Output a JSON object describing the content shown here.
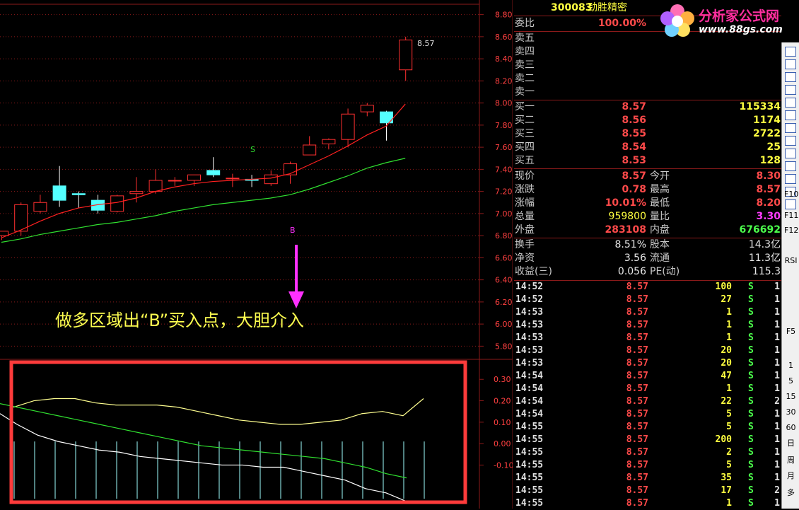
{
  "stock": {
    "code": "300083",
    "name": "劲胜精密"
  },
  "annotation": {
    "text": "做多区域出“B”买入点，大胆介入",
    "buy_marker": "B",
    "sell_marker": "S",
    "last_label": "8.57"
  },
  "price_axis": [
    "8.80",
    "8.60",
    "8.40",
    "8.20",
    "8.00",
    "7.80",
    "7.60",
    "7.40",
    "7.20",
    "7.00",
    "6.80",
    "6.60",
    "6.40",
    "6.20",
    "6.00",
    "5.80"
  ],
  "indicator_axis": [
    "0.30",
    "0.20",
    "0.10",
    "0.00",
    "-0.10"
  ],
  "colors": {
    "up": "#ff3030",
    "down": "#54ffff",
    "ma_short": "#ff2020",
    "ma_long": "#30e030",
    "highlight_box": "#ff3b3b",
    "grid": "#8b1a1a",
    "arrow": "#ff30ff"
  },
  "chart_data": [
    {
      "type": "candlestick",
      "ylim": [
        5.7,
        8.9
      ],
      "candles": [
        {
          "o": 6.8,
          "h": 6.84,
          "l": 6.76,
          "c": 6.84
        },
        {
          "o": 6.84,
          "h": 7.1,
          "l": 6.8,
          "c": 7.08
        },
        {
          "o": 7.02,
          "h": 7.17,
          "l": 7.0,
          "c": 7.1
        },
        {
          "o": 7.25,
          "h": 7.43,
          "l": 7.06,
          "c": 7.12
        },
        {
          "o": 7.18,
          "h": 7.2,
          "l": 7.05,
          "c": 7.17
        },
        {
          "o": 7.12,
          "h": 7.17,
          "l": 7.0,
          "c": 7.03
        },
        {
          "o": 7.02,
          "h": 7.17,
          "l": 7.01,
          "c": 7.16
        },
        {
          "o": 7.18,
          "h": 7.33,
          "l": 7.1,
          "c": 7.2
        },
        {
          "o": 7.2,
          "h": 7.4,
          "l": 7.18,
          "c": 7.3
        },
        {
          "o": 7.3,
          "h": 7.33,
          "l": 7.25,
          "c": 7.3
        },
        {
          "o": 7.3,
          "h": 7.35,
          "l": 7.25,
          "c": 7.35
        },
        {
          "o": 7.39,
          "h": 7.51,
          "l": 7.33,
          "c": 7.35
        },
        {
          "o": 7.32,
          "h": 7.36,
          "l": 7.24,
          "c": 7.32
        },
        {
          "o": 7.31,
          "h": 7.35,
          "l": 7.24,
          "c": 7.3
        },
        {
          "o": 7.27,
          "h": 7.39,
          "l": 7.25,
          "c": 7.35
        },
        {
          "o": 7.35,
          "h": 7.47,
          "l": 7.27,
          "c": 7.45
        },
        {
          "o": 7.53,
          "h": 7.7,
          "l": 7.53,
          "c": 7.62
        },
        {
          "o": 7.63,
          "h": 7.68,
          "l": 7.58,
          "c": 7.67
        },
        {
          "o": 7.67,
          "h": 7.95,
          "l": 7.6,
          "c": 7.9
        },
        {
          "o": 7.92,
          "h": 8.0,
          "l": 7.88,
          "c": 7.98
        },
        {
          "o": 7.92,
          "h": 7.93,
          "l": 7.66,
          "c": 7.82
        },
        {
          "o": 8.3,
          "h": 8.6,
          "l": 8.2,
          "c": 8.57
        }
      ],
      "ma_short": [
        6.78,
        6.85,
        6.93,
        7.0,
        7.05,
        7.08,
        7.1,
        7.14,
        7.2,
        7.24,
        7.27,
        7.29,
        7.3,
        7.31,
        7.32,
        7.36,
        7.44,
        7.52,
        7.61,
        7.71,
        7.79,
        7.99
      ],
      "ma_long": [
        6.74,
        6.77,
        6.81,
        6.84,
        6.87,
        6.9,
        6.92,
        6.95,
        6.98,
        7.02,
        7.05,
        7.08,
        7.1,
        7.12,
        7.14,
        7.17,
        7.22,
        7.28,
        7.34,
        7.41,
        7.46,
        7.5
      ]
    },
    {
      "type": "line",
      "ylim": [
        -0.28,
        0.38
      ],
      "series": [
        {
          "values": [
            0.17,
            0.2,
            0.21,
            0.21,
            0.19,
            0.18,
            0.18,
            0.18,
            0.17,
            0.15,
            0.13,
            0.11,
            0.1,
            0.09,
            0.09,
            0.1,
            0.11,
            0.14,
            0.15,
            0.13,
            0.21
          ]
        },
        {
          "values": [
            0.19,
            0.17,
            0.15,
            0.13,
            0.11,
            0.09,
            0.07,
            0.05,
            0.03,
            0.01,
            -0.01,
            -0.02,
            -0.03,
            -0.04,
            -0.05,
            -0.06,
            -0.07,
            -0.09,
            -0.11,
            -0.14,
            -0.16
          ]
        },
        {
          "values": [
            0.15,
            0.09,
            0.04,
            0.01,
            -0.01,
            -0.03,
            -0.04,
            -0.06,
            -0.07,
            -0.08,
            -0.09,
            -0.1,
            -0.1,
            -0.11,
            -0.11,
            -0.13,
            -0.15,
            -0.17,
            -0.21,
            -0.23,
            -0.27
          ]
        }
      ]
    }
  ],
  "quote": {
    "webi": {
      "label": "委比",
      "value": "100.00%"
    },
    "sell": [
      "卖五",
      "卖四",
      "卖三",
      "卖二",
      "卖一"
    ],
    "buy": [
      {
        "label": "买一",
        "price": "8.57",
        "vol": "115334"
      },
      {
        "label": "买二",
        "price": "8.56",
        "vol": "1174"
      },
      {
        "label": "买三",
        "price": "8.55",
        "vol": "2722"
      },
      {
        "label": "买四",
        "price": "8.54",
        "vol": "25"
      },
      {
        "label": "买五",
        "price": "8.53",
        "vol": "128"
      }
    ],
    "stats": [
      {
        "l1": "现价",
        "v1": "8.57",
        "l2": "今开",
        "v2": "8.30"
      },
      {
        "l1": "涨跌",
        "v1": "0.78",
        "l2": "最高",
        "v2": "8.57"
      },
      {
        "l1": "涨幅",
        "v1": "10.01%",
        "l2": "最低",
        "v2": "8.20"
      },
      {
        "l1": "总量",
        "v1": "959800",
        "l2": "量比",
        "v2": "3.30"
      },
      {
        "l1": "外盘",
        "v1": "283108",
        "l2": "内盘",
        "v2": "676692"
      }
    ],
    "fin": [
      {
        "l1": "换手",
        "v1": "8.51%",
        "l2": "股本",
        "v2": "14.3亿"
      },
      {
        "l1": "净资",
        "v1": "3.56",
        "l2": "流通",
        "v2": "11.3亿"
      },
      {
        "l1": "收益(三)",
        "v1": "0.056",
        "l2": "PE(动)",
        "v2": "115.3"
      }
    ],
    "ticks": [
      {
        "t": "14:52",
        "p": "8.57",
        "q": "100",
        "s": "S",
        "n": "1"
      },
      {
        "t": "14:52",
        "p": "8.57",
        "q": "27",
        "s": "S",
        "n": "1"
      },
      {
        "t": "14:53",
        "p": "8.57",
        "q": "1",
        "s": "S",
        "n": "1"
      },
      {
        "t": "14:53",
        "p": "8.57",
        "q": "1",
        "s": "S",
        "n": "1"
      },
      {
        "t": "14:53",
        "p": "8.57",
        "q": "1",
        "s": "S",
        "n": "1"
      },
      {
        "t": "14:53",
        "p": "8.57",
        "q": "20",
        "s": "S",
        "n": "1"
      },
      {
        "t": "14:53",
        "p": "8.57",
        "q": "20",
        "s": "S",
        "n": "1"
      },
      {
        "t": "14:54",
        "p": "8.57",
        "q": "47",
        "s": "S",
        "n": "1"
      },
      {
        "t": "14:54",
        "p": "8.57",
        "q": "1",
        "s": "S",
        "n": "1"
      },
      {
        "t": "14:54",
        "p": "8.57",
        "q": "22",
        "s": "S",
        "n": "2"
      },
      {
        "t": "14:54",
        "p": "8.57",
        "q": "5",
        "s": "S",
        "n": "1"
      },
      {
        "t": "14:55",
        "p": "8.57",
        "q": "5",
        "s": "S",
        "n": "1"
      },
      {
        "t": "14:55",
        "p": "8.57",
        "q": "200",
        "s": "S",
        "n": "1"
      },
      {
        "t": "14:55",
        "p": "8.57",
        "q": "2",
        "s": "S",
        "n": "1"
      },
      {
        "t": "14:55",
        "p": "8.57",
        "q": "5",
        "s": "S",
        "n": "1"
      },
      {
        "t": "14:55",
        "p": "8.57",
        "q": "35",
        "s": "S",
        "n": "1"
      },
      {
        "t": "14:55",
        "p": "8.57",
        "q": "17",
        "s": "S",
        "n": "2"
      },
      {
        "t": "14:55",
        "p": "8.57",
        "q": "1",
        "s": "S",
        "n": "1"
      }
    ]
  },
  "toolbar": {
    "buttons": [
      "F10",
      "F11",
      "F12",
      "RSI",
      "F5",
      "1",
      "5",
      "15",
      "30",
      "60",
      "日",
      "周",
      "月",
      "多"
    ]
  },
  "logo": {
    "title": "分析家公式网",
    "url": "www.88gs.com"
  }
}
